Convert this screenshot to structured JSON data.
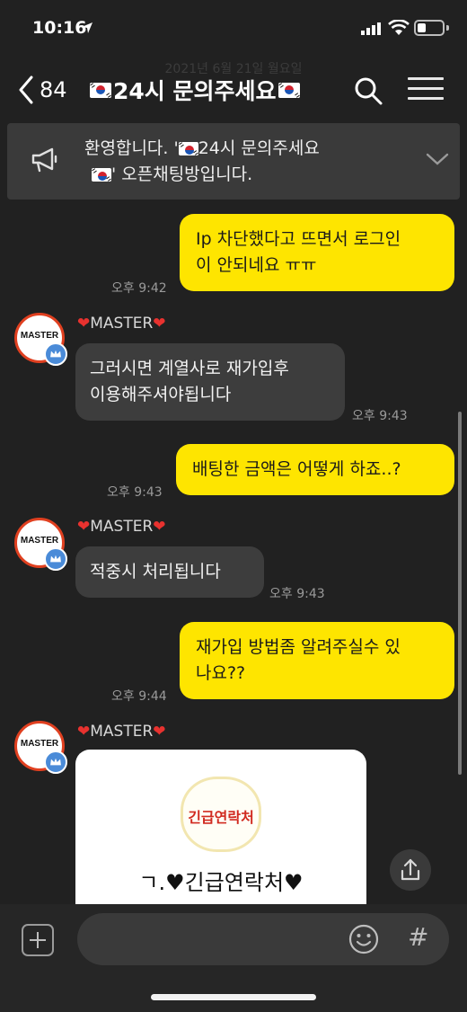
{
  "status": {
    "time": "10:16"
  },
  "header": {
    "date_ghost": "2021년 6월 21일 월요일",
    "back_count": "84",
    "title": "24시 문의주세요"
  },
  "notice": {
    "line1": "환영합니다. '",
    "line1_b": "24시 문의주세요",
    "line2": "' 오픈채팅방입니다."
  },
  "messages": [
    {
      "from": "me",
      "text": [
        "Ip 차단했다고 뜨면서 로그인",
        "이 안되네요 ㅠㅠ"
      ],
      "time": "오후 9:42"
    },
    {
      "from": "other",
      "sender": "MASTER",
      "text": [
        "그러시면 계열사로 재가입후",
        "이용해주셔야됩니다"
      ],
      "time": "오후 9:43"
    },
    {
      "from": "me",
      "text": [
        "배팅한 금액은 어떻게 하죠..?"
      ],
      "time": "오후 9:43"
    },
    {
      "from": "other",
      "sender": "MASTER",
      "text": [
        "적중시 처리됩니다"
      ],
      "time": "오후 9:43"
    },
    {
      "from": "me",
      "text": [
        "재가입 방법좀 알려주실수 있",
        "나요??"
      ],
      "time": "오후 9:44"
    },
    {
      "from": "other",
      "sender": "MASTER",
      "image": {
        "logo_text": "긴급연락처",
        "caption": "ㄱ.♥긴급연락처♥"
      }
    }
  ],
  "avatar_label": "MASTER",
  "input": {
    "placeholder": ""
  },
  "icons": [
    "location-arrow-icon",
    "signal-icon",
    "wifi-icon",
    "battery-icon",
    "back-chevron-icon",
    "flag-icon",
    "search-icon",
    "menu-icon",
    "megaphone-icon",
    "chevron-down-icon",
    "crown-icon",
    "share-icon",
    "plus-icon",
    "emoji-icon",
    "hash-icon"
  ],
  "colors": {
    "background": "#212121",
    "my_bubble": "#fee500",
    "other_bubble": "#3d3d3d",
    "notice": "#3a3a3a",
    "heart": "#e8322f"
  }
}
